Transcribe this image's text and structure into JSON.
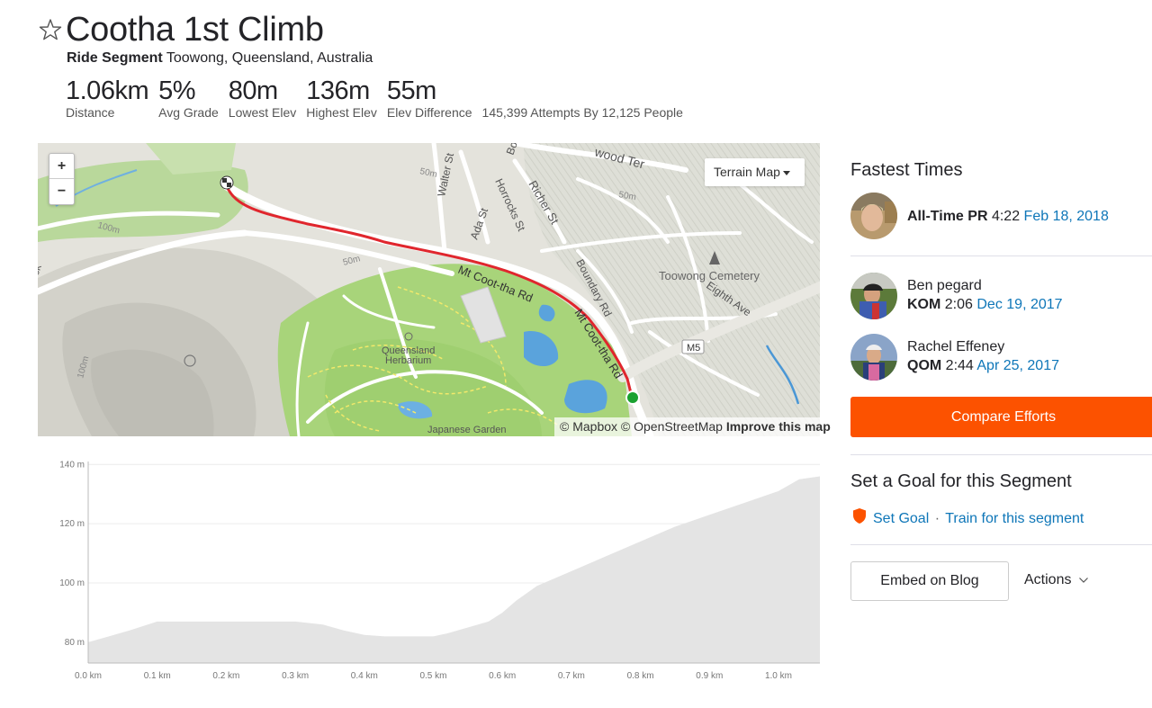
{
  "segment": {
    "title": "Cootha 1st Climb",
    "type_label": "Ride Segment",
    "location": "Toowong, Queensland, Australia"
  },
  "stats": [
    {
      "value": "1.06km",
      "label": "Distance"
    },
    {
      "value": "5%",
      "label": "Avg Grade"
    },
    {
      "value": "80m",
      "label": "Lowest Elev"
    },
    {
      "value": "136m",
      "label": "Highest Elev"
    },
    {
      "value": "55m",
      "label": "Elev Difference"
    }
  ],
  "attempts": "145,399 Attempts By 12,125 People",
  "map": {
    "zoom_in": "+",
    "zoom_out": "−",
    "terrain_button": "Terrain Map",
    "attribution_mapbox": "© Mapbox",
    "attribution_osm": "© OpenStreetMap",
    "attribution_improve": "Improve this map",
    "labels": {
      "wood_ter": "wood Ter",
      "walter_st": "Walter St",
      "horrocks_st": "Horrocks St",
      "richer_st": "Richer St",
      "ada_st": "Ada St",
      "boundary_rd": "Boundary Rd",
      "mt_cootha_rd1": "Mt Coot-tha Rd",
      "mt_cootha_rd2": "Mt Coot-tha Rd",
      "toowong_cemetery": "Toowong Cemetery",
      "eighth_ave": "Eighth Ave",
      "m5": "M5",
      "qld_herbarium_1": "Queensland",
      "qld_herbarium_2": "Herbarium",
      "japanese_garden": "Japanese Garden",
      "c50a": "50m",
      "c50b": "50m",
      "c50c": "50m",
      "c100a": "100m",
      "c100b": "100m",
      "ck": "ck",
      "bo": "Bo"
    }
  },
  "chart_data": {
    "type": "area",
    "title": "",
    "xlabel": "",
    "ylabel": "",
    "x_ticks": [
      "0.0 km",
      "0.1 km",
      "0.2 km",
      "0.3 km",
      "0.4 km",
      "0.5 km",
      "0.6 km",
      "0.7 km",
      "0.8 km",
      "0.9 km",
      "1.0 km"
    ],
    "y_ticks": [
      "80 m",
      "100 m",
      "120 m",
      "140 m"
    ],
    "xlim": [
      0,
      1.06
    ],
    "ylim": [
      73,
      141
    ],
    "x": [
      0,
      0.03,
      0.06,
      0.1,
      0.15,
      0.2,
      0.25,
      0.3,
      0.34,
      0.37,
      0.4,
      0.43,
      0.47,
      0.5,
      0.52,
      0.55,
      0.58,
      0.6,
      0.62,
      0.65,
      0.7,
      0.75,
      0.8,
      0.85,
      0.9,
      0.95,
      1.0,
      1.03,
      1.06
    ],
    "values": [
      80,
      82,
      84,
      87,
      87,
      87,
      87,
      87,
      86,
      84,
      82.5,
      82,
      82,
      82,
      83,
      85,
      87,
      90,
      94,
      99,
      104,
      109,
      114,
      119,
      123,
      127,
      131,
      135,
      136
    ]
  },
  "right": {
    "fastest_title": "Fastest Times",
    "pr": {
      "label": "All-Time PR",
      "time": "4:22",
      "date": "Feb 18, 2018"
    },
    "kom": {
      "name": "Ben pegard",
      "label": "KOM",
      "time": "2:06",
      "date": "Dec 19, 2017"
    },
    "qom": {
      "name": "Rachel Effeney",
      "label": "QOM",
      "time": "2:44",
      "date": "Apr 25, 2017"
    },
    "compare_button": "Compare Efforts",
    "goal_title": "Set a Goal for this Segment",
    "set_goal": "Set Goal",
    "dot_sep": "·",
    "train": "Train for this segment",
    "embed_button": "Embed on Blog",
    "actions": "Actions"
  },
  "colors": {
    "accent": "#fc5200",
    "link": "#0e76b8",
    "route": "#e0262d",
    "start": "#1aa130"
  }
}
